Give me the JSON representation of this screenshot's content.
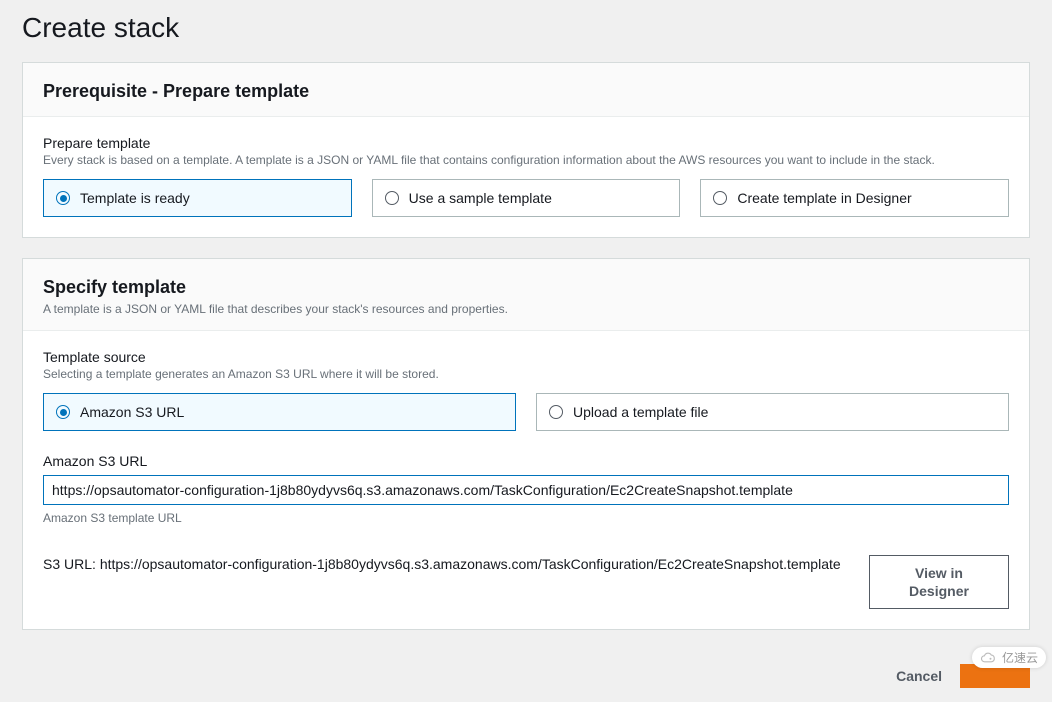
{
  "page": {
    "title": "Create stack"
  },
  "prerequisite": {
    "panel_title": "Prerequisite - Prepare template",
    "section_title": "Prepare template",
    "section_desc": "Every stack is based on a template. A template is a JSON or YAML file that contains configuration information about the AWS resources you want to include in the stack.",
    "options": [
      {
        "label": "Template is ready",
        "selected": true
      },
      {
        "label": "Use a sample template",
        "selected": false
      },
      {
        "label": "Create template in Designer",
        "selected": false
      }
    ]
  },
  "specify": {
    "panel_title": "Specify template",
    "panel_subtitle": "A template is a JSON or YAML file that describes your stack's resources and properties.",
    "source": {
      "section_title": "Template source",
      "section_desc": "Selecting a template generates an Amazon S3 URL where it will be stored.",
      "options": [
        {
          "label": "Amazon S3 URL",
          "selected": true
        },
        {
          "label": "Upload a template file",
          "selected": false
        }
      ]
    },
    "s3": {
      "label": "Amazon S3 URL",
      "value": "https://opsautomator-configuration-1j8b80ydyvs6q.s3.amazonaws.com/TaskConfiguration/Ec2CreateSnapshot.template",
      "help": "Amazon S3 template URL"
    },
    "display": {
      "label": "S3 URL:",
      "value": "https://opsautomator-configuration-1j8b80ydyvs6q.s3.amazonaws.com/TaskConfiguration/Ec2CreateSnapshot.template",
      "view_button": "View in Designer"
    }
  },
  "footer": {
    "cancel": "Cancel"
  },
  "watermark": {
    "text": "亿速云"
  }
}
